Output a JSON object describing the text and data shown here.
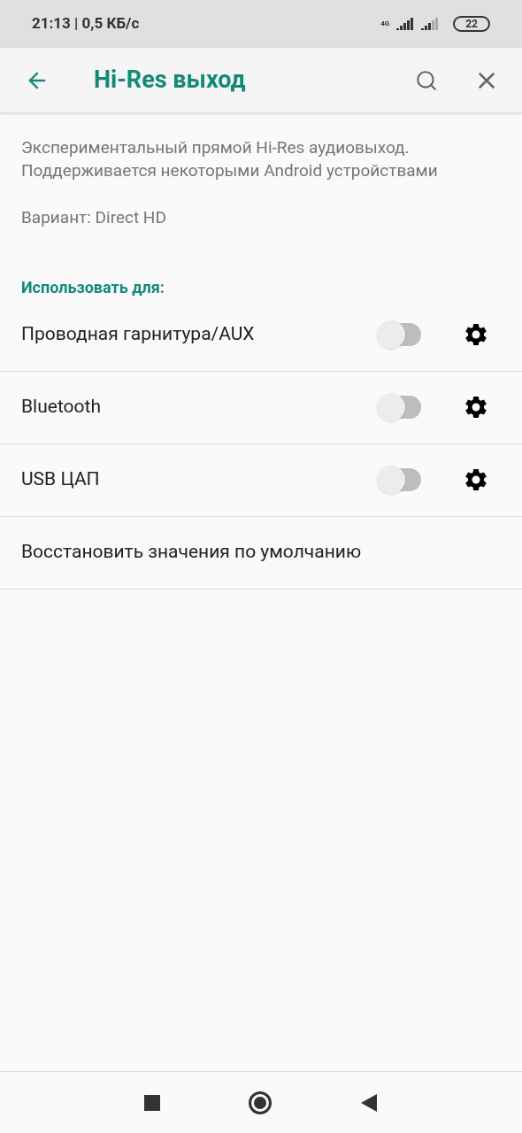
{
  "status_bar": {
    "time": "21:13 | 0,5 КБ/с",
    "network": "4G",
    "battery": "22"
  },
  "toolbar": {
    "title": "Hi-Res выход"
  },
  "description": "Экспериментальный прямой Hi-Res аудиовыход. Поддерживается некоторыми Android устройствами",
  "variant": "Вариант: Direct HD",
  "section_title": "Использовать для:",
  "outputs": [
    {
      "label": "Проводная гарнитура/AUX",
      "on": false
    },
    {
      "label": "Bluetooth",
      "on": false
    },
    {
      "label": "USB ЦАП",
      "on": false
    }
  ],
  "reset_label": "Восстановить значения по умолчанию"
}
